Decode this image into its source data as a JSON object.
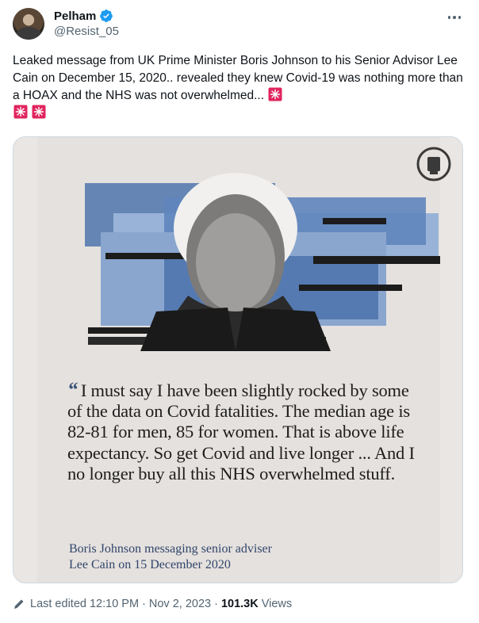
{
  "author": {
    "display_name": "Pelham",
    "handle": "@Resist_05",
    "verified": true
  },
  "tweet": {
    "text": "Leaked message from UK Prime Minister Boris Johnson to his Senior Advisor Lee Cain on December 15, 2020.. revealed they knew Covid-19 was nothing more than a HOAX and the NHS was not overwhelmed...",
    "emojis": [
      "police-car-light",
      "police-car-light",
      "police-car-light"
    ]
  },
  "media": {
    "quote_mark": "“",
    "quote": "I must say I have been slightly rocked by some of the data on Covid fatalities. The median age is 82-81 for men, 85 for women. That is above life expectancy. So get Covid and live longer ... And I no longer buy all this NHS overwhelmed stuff.",
    "attribution_line1": "Boris Johnson messaging senior adviser",
    "attribution_line2": "Lee Cain on 15 December 2020",
    "accent_color": "#3d5479"
  },
  "footer": {
    "edited_label": "Last edited 12:10 PM",
    "separator": "·",
    "date": "Nov 2, 2023",
    "views_count": "101.3K",
    "views_label": "Views"
  },
  "colors": {
    "text_primary": "#0f1419",
    "text_secondary": "#536471",
    "verified_blue": "#1d9bf0",
    "border": "#cfd9de"
  }
}
